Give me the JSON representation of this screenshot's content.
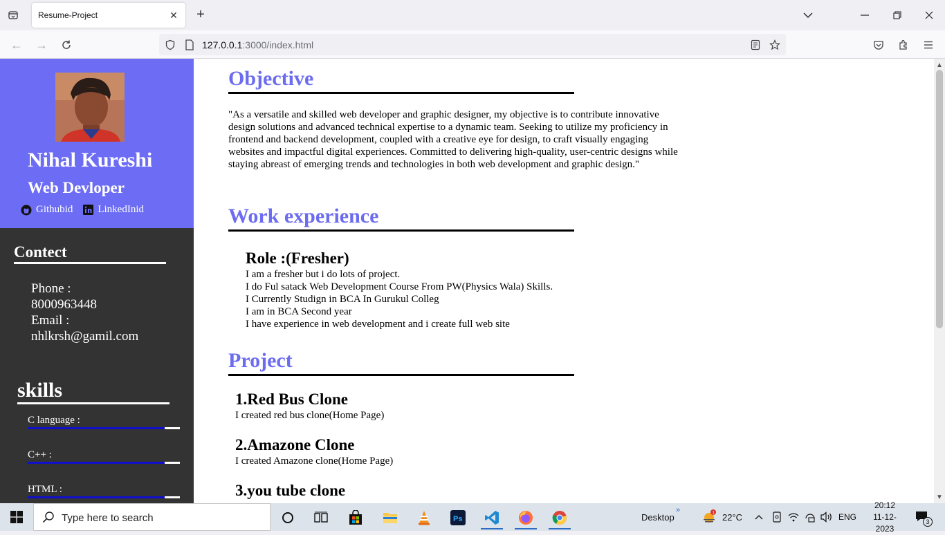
{
  "browser": {
    "tab_title": "Resume-Project",
    "url_host": "127.0.0.1",
    "url_rest": ":3000/index.html"
  },
  "sidebar": {
    "name": "Nihal Kureshi",
    "role": "Web Devloper",
    "links": [
      {
        "label": "Githubid",
        "icon": "github-icon"
      },
      {
        "label": "LinkedInid",
        "icon": "linkedin-icon"
      }
    ],
    "contact_title": "Contect",
    "contact": [
      "Phone :",
      "8000963448",
      "Email :",
      "nhlkrsh@gamil.com"
    ],
    "skills_title": "skills",
    "skills": [
      {
        "label": "C language :",
        "level": 0.9
      },
      {
        "label": "C++ :",
        "level": 0.9
      },
      {
        "label": "HTML :",
        "level": 0.9
      }
    ]
  },
  "main": {
    "objective_title": "Objective",
    "objective_text": "\"As a versatile and skilled web developer and graphic designer, my objective is to contribute innovative design solutions and advanced technical expertise to a dynamic team. Seeking to utilize my proficiency in frontend and backend development, coupled with a creative eye for design, to craft visually engaging websites and impactful digital experiences. Committed to delivering high-quality, user-centric designs while staying abreast of emerging trends and technologies in both web development and graphic design.\"",
    "work_title": "Work experience",
    "work_role": "Role :(Fresher)",
    "work_lines": [
      "I am a fresher but i do lots of project.",
      "I do Ful satack Web Development Course From PW(Physics Wala) Skills.",
      "I Currently Studign in BCA In Gurukul Colleg",
      "I am in BCA Second year",
      "I have experience in web development and i create full web site"
    ],
    "project_title": "Project",
    "projects": [
      {
        "name": "1.Red Bus Clone",
        "desc": "I created red bus clone(Home Page)"
      },
      {
        "name": "2.Amazone Clone",
        "desc": "I created Amazone clone(Home Page)"
      },
      {
        "name": "3.you tube clone",
        "desc": ""
      }
    ]
  },
  "taskbar": {
    "search_placeholder": "Type here to search",
    "desktop_label": "Desktop",
    "weather": "22°C",
    "lang": "ENG",
    "time": "20:12",
    "date": "11-12-2023",
    "notif_count": "3"
  },
  "colors": {
    "accent": "#6c6cf5",
    "sidebar_dark": "#333333",
    "heading": "#6c6cf0",
    "skill_bar": "#1010cc"
  }
}
